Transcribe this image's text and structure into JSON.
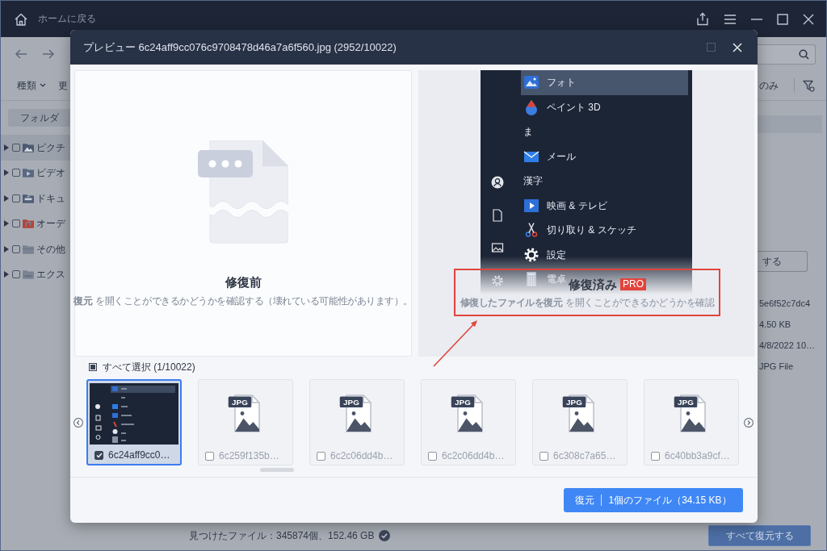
{
  "app": {
    "title_bar": {
      "home_label": "ホームに戻る"
    },
    "filters": [
      {
        "label": "種類",
        "dropdown": true
      },
      {
        "label": "更",
        "dropdown": false
      }
    ],
    "sidebar": {
      "tab": "フォルダ",
      "tree": [
        {
          "label": "ピクチ",
          "kind": "pictures",
          "selected": true,
          "expanded": false,
          "checked": false
        },
        {
          "label": "ビデオ",
          "kind": "videos",
          "selected": false,
          "expanded": false,
          "checked": false
        },
        {
          "label": "ドキュ",
          "kind": "documents",
          "selected": false,
          "expanded": false,
          "checked": false
        },
        {
          "label": "オーデ",
          "kind": "audio",
          "selected": false,
          "expanded": false,
          "checked": false
        },
        {
          "label": "その他",
          "kind": "other",
          "selected": false,
          "expanded": false,
          "checked": false
        },
        {
          "label": "エクス",
          "kind": "external",
          "selected": false,
          "expanded": false,
          "checked": false
        }
      ]
    },
    "filter_suffix": "のみ",
    "action_button": "する",
    "details": [
      "5e6f52c7dc4",
      "4.50 KB",
      "4/8/2022 10…",
      "JPG File"
    ],
    "status": "見つけたファイル：345874個、152.46 GB",
    "recover_all_button": "すべて復元する"
  },
  "dialog": {
    "title": "プレビュー 6c24aff9cc076c9708478d46a7a6f560.jpg (2952/10022)",
    "before": {
      "heading": "修復前",
      "link": "復元",
      "text": "を開くことができるかどうかを確認する（壊れている可能性があります）。"
    },
    "after": {
      "heading": "修復済み",
      "badge": "PRO",
      "link": "修復したファイルを復元",
      "text": "を開くことができるかどうかを確認",
      "preview_items": [
        {
          "label": "フォト",
          "kind": "photos",
          "selected": true
        },
        {
          "label": "ペイント 3D",
          "kind": "paint",
          "selected": false
        },
        {
          "label": "ま",
          "kind": "header",
          "selected": false
        },
        {
          "label": "メール",
          "kind": "mail",
          "selected": false
        },
        {
          "label": "漢字",
          "kind": "header",
          "selected": false
        },
        {
          "label": "映画 & テレビ",
          "kind": "video",
          "selected": false
        },
        {
          "label": "切り取り & スケッチ",
          "kind": "snip",
          "selected": false
        },
        {
          "label": "設定",
          "kind": "settings",
          "selected": false
        },
        {
          "label": "電卓",
          "kind": "calculator",
          "selected": false
        }
      ]
    },
    "select_all": {
      "label": "すべて選択 (1/10022)",
      "indeterminate": true
    },
    "thumbnails": [
      {
        "name": "6c24aff9cc0…",
        "kind": "screenshot",
        "selected": true,
        "checked": true
      },
      {
        "name": "6c259f135b…",
        "kind": "file",
        "file_type": "JPG",
        "selected": false,
        "checked": false
      },
      {
        "name": "6c2c06dd4b…",
        "kind": "file",
        "file_type": "JPG",
        "selected": false,
        "checked": false
      },
      {
        "name": "6c2c06dd4b…",
        "kind": "file",
        "file_type": "JPG",
        "selected": false,
        "checked": false
      },
      {
        "name": "6c308c7a65…",
        "kind": "file",
        "file_type": "JPG",
        "selected": false,
        "checked": false
      },
      {
        "name": "6c40bb3a9cf…",
        "kind": "file",
        "file_type": "JPG",
        "selected": false,
        "checked": false
      }
    ],
    "restore_button": {
      "label": "復元",
      "detail": "1個のファイル（34.15 KB）"
    }
  }
}
